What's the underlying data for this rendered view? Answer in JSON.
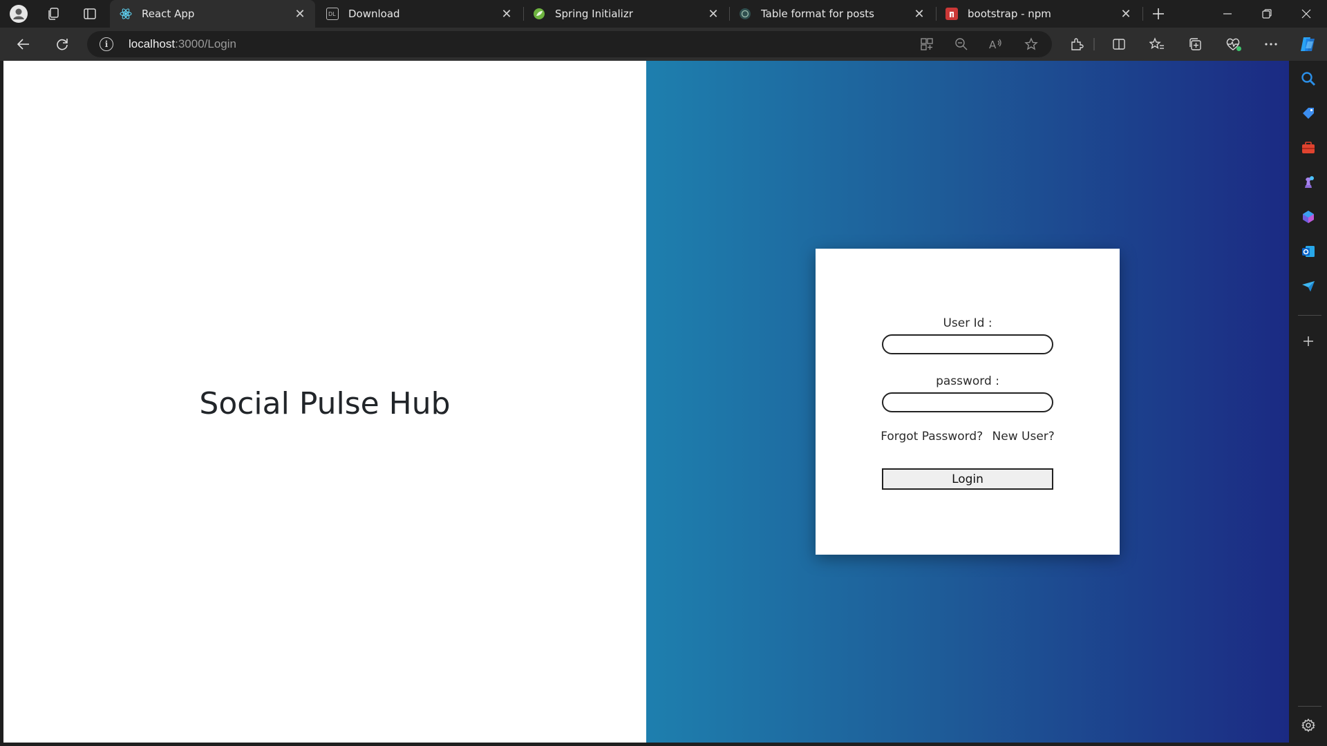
{
  "browser": {
    "tabs": [
      {
        "title": "React App",
        "active": true,
        "favicon": "react-icon"
      },
      {
        "title": "Download",
        "active": false,
        "favicon": "download-page-icon"
      },
      {
        "title": "Spring Initializr",
        "active": false,
        "favicon": "spring-icon"
      },
      {
        "title": "Table format for posts",
        "active": false,
        "favicon": "chatgpt-icon"
      },
      {
        "title": "bootstrap - npm",
        "active": false,
        "favicon": "npm-icon"
      }
    ],
    "address": {
      "host": "localhost",
      "path": ":3000/Login"
    },
    "colors": {
      "frame": "#1f1f1f",
      "toolbar": "#2e2e2e"
    }
  },
  "page": {
    "brand_title": "Social Pulse Hub",
    "login": {
      "user_label": "User Id :",
      "password_label": "password :",
      "user_value": "",
      "password_value": "",
      "forgot_link": "Forgot Password?",
      "new_user_link": "New User?",
      "login_button": "Login"
    },
    "colors": {
      "gradient_start": "#1e7fae",
      "gradient_end": "#1b2a83"
    }
  }
}
